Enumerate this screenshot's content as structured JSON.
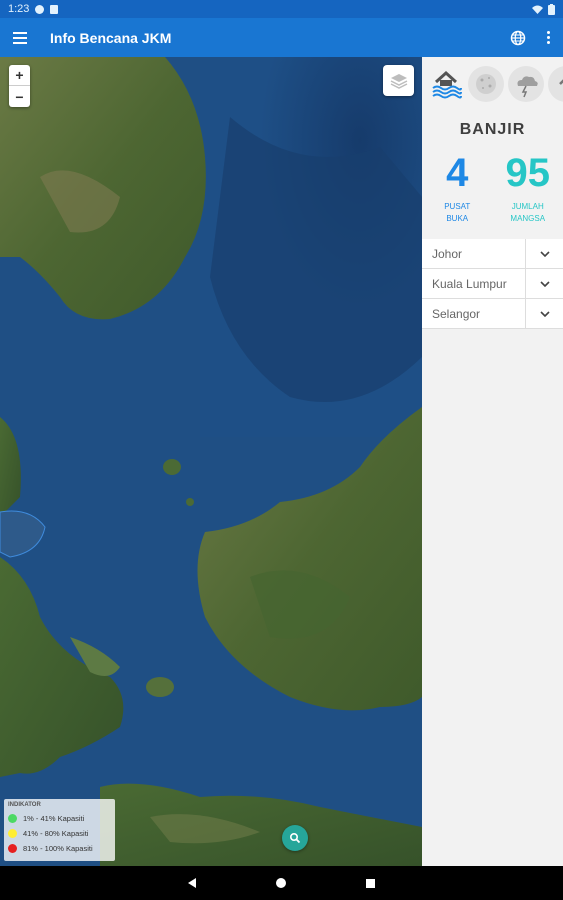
{
  "status_bar": {
    "time": "1:23"
  },
  "app_bar": {
    "title": "Info Bencana JKM",
    "menu_icon": "menu-icon",
    "language_icon": "globe-icon",
    "overflow_icon": "more-vert-icon"
  },
  "map": {
    "zoom_in_label": "+",
    "zoom_out_label": "−",
    "layers_icon": "layers-icon",
    "search_icon": "search-icon",
    "legend": {
      "title": "INDIKATOR",
      "items": [
        {
          "label": "1% - 41% Kapasiti",
          "color": "#4cd964"
        },
        {
          "label": "41% - 80% Kapasiti",
          "color": "#ffee33"
        },
        {
          "label": "81% - 100% Kapasiti",
          "color": "#e62020"
        }
      ]
    }
  },
  "panel": {
    "disaster_types": [
      {
        "icon": "flood-icon",
        "active": true
      },
      {
        "icon": "haze-icon",
        "active": false
      },
      {
        "icon": "storm-icon",
        "active": false
      },
      {
        "icon": "landslide-icon",
        "active": false
      }
    ],
    "disaster_name": "BANJIR",
    "stats": [
      {
        "value": "4",
        "label_line1": "PUSAT",
        "label_line2": "BUKA",
        "color": "#1e88e5"
      },
      {
        "value": "95",
        "label_line1": "JUMLAH",
        "label_line2": "MANGSA",
        "color": "#26c6c6"
      }
    ],
    "states": [
      {
        "name": "Johor"
      },
      {
        "name": "Kuala Lumpur"
      },
      {
        "name": "Selangor"
      }
    ]
  }
}
